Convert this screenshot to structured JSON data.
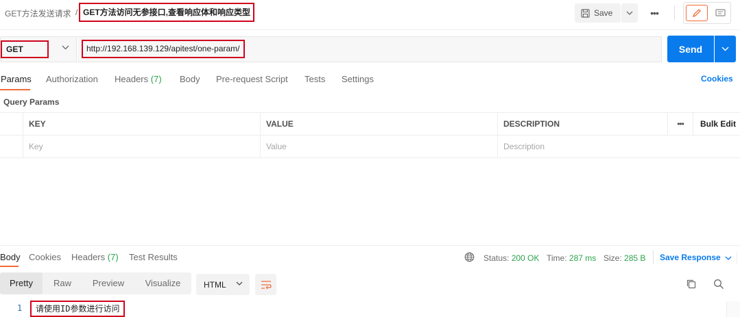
{
  "header": {
    "collection": "GET方法发送请求",
    "separator": "/",
    "request_name": "GET方法访问无参接口,查看响应体和响应类型",
    "save_label": "Save",
    "more_label": "•••"
  },
  "url_bar": {
    "method": "GET",
    "url": "http://192.168.139.129/apitest/one-param/",
    "send_label": "Send"
  },
  "request_tabs": {
    "params": "Params",
    "authorization": "Authorization",
    "headers": "Headers",
    "headers_count": "(7)",
    "body": "Body",
    "pre_request": "Pre-request Script",
    "tests": "Tests",
    "settings": "Settings",
    "cookies": "Cookies"
  },
  "query_params": {
    "label": "Query Params",
    "columns": [
      "KEY",
      "VALUE",
      "DESCRIPTION"
    ],
    "more_label": "•••",
    "bulk_edit": "Bulk Edit",
    "placeholders": [
      "Key",
      "Value",
      "Description"
    ]
  },
  "response": {
    "tabs": {
      "body": "Body",
      "cookies": "Cookies",
      "headers": "Headers",
      "headers_count": "(7)",
      "test_results": "Test Results"
    },
    "status_label": "Status:",
    "status_value": "200 OK",
    "time_label": "Time:",
    "time_value": "287 ms",
    "size_label": "Size:",
    "size_value": "285 B",
    "save_response": "Save Response",
    "view_tabs": [
      "Pretty",
      "Raw",
      "Preview",
      "Visualize"
    ],
    "format": "HTML",
    "line_number": "1",
    "body_text": "请使用ID参数进行访问"
  },
  "colors": {
    "accent": "#f26b3a",
    "send": "#097bed",
    "status_ok": "#2ba24c",
    "highlight_box": "#d0021b"
  }
}
